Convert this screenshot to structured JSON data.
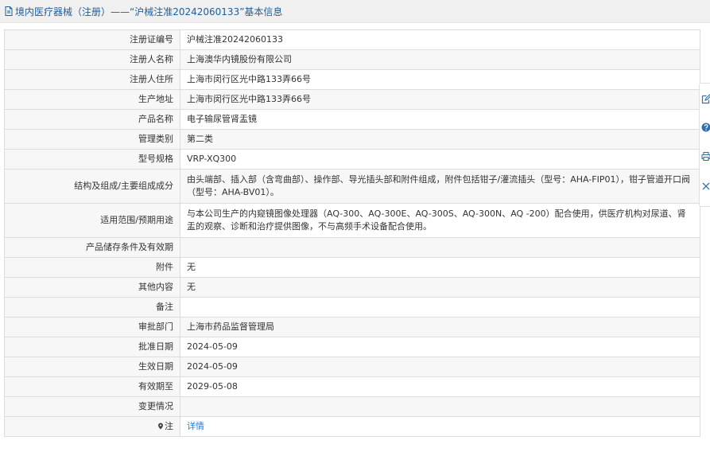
{
  "header": {
    "title": "境内医疗器械（注册）——“沪械注准20242060133”基本信息"
  },
  "rows": [
    {
      "label": "注册证编号",
      "value": "沪械注准20242060133"
    },
    {
      "label": "注册人名称",
      "value": "上海澳华内镜股份有限公司"
    },
    {
      "label": "注册人住所",
      "value": "上海市闵行区光中路133弄66号"
    },
    {
      "label": "生产地址",
      "value": "上海市闵行区光中路133弄66号"
    },
    {
      "label": "产品名称",
      "value": "电子输尿管肾盂镜"
    },
    {
      "label": "管理类别",
      "value": "第二类"
    },
    {
      "label": "型号规格",
      "value": "VRP-XQ300"
    },
    {
      "label": "结构及组成/主要组成成分",
      "value": "由头端部、插入部（含弯曲部）、操作部、导光插头部和附件组成，附件包括钳子/灌流插头（型号：AHA-FIP01），钳子管道开口阀（型号：AHA-BV01）。"
    },
    {
      "label": "适用范围/预期用途",
      "value": "与本公司生产的内窥镜图像处理器（AQ-300、AQ-300E、AQ-300S、AQ-300N、AQ -200）配合使用，供医疗机构对尿道、肾盂的观察、诊断和治疗提供图像，不与高频手术设备配合使用。"
    },
    {
      "label": "产品储存条件及有效期",
      "value": ""
    },
    {
      "label": "附件",
      "value": "无"
    },
    {
      "label": "其他内容",
      "value": "无"
    },
    {
      "label": "备注",
      "value": ""
    },
    {
      "label": "审批部门",
      "value": "上海市药品监督管理局"
    },
    {
      "label": "批准日期",
      "value": "2024-05-09"
    },
    {
      "label": "生效日期",
      "value": "2024-05-09"
    },
    {
      "label": "有效期至",
      "value": "2029-05-08"
    },
    {
      "label": "变更情况",
      "value": ""
    },
    {
      "label": "注",
      "value": "详情"
    }
  ],
  "side_tools": [
    "edit-icon",
    "help-icon",
    "print-icon",
    "close-icon"
  ],
  "colors": {
    "title": "#1f5e9b",
    "link": "#2f7bc4",
    "label_bg": "#f7f7f7",
    "border": "#dcdcdc"
  }
}
